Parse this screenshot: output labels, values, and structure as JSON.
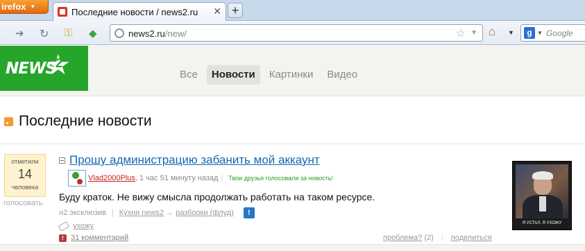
{
  "browser": {
    "app_button": "irefox",
    "tab_title": "Последние новости / news2.ru",
    "url_domain": "news2.ru",
    "url_path": "/new/",
    "search_placeholder": "Google"
  },
  "site": {
    "nav": [
      {
        "label": "Все",
        "active": false
      },
      {
        "label": "Новости",
        "active": true
      },
      {
        "label": "Картинки",
        "active": false
      },
      {
        "label": "Видео",
        "active": false
      }
    ]
  },
  "section": {
    "title": "Последние новости"
  },
  "story": {
    "votes_label_top": "отметили",
    "votes_count": "14",
    "votes_label_bottom": "человека",
    "vote_link": "голосовать",
    "title": "Прошу администрацию забанить мой аккаунт",
    "author": "Vlad2000Plus",
    "time": ", 1 час 51 минуту назад",
    "friends_note": "Твои друзья голосовали за новость!",
    "lead": "Буду краток. Не вижу смысла продолжать работать на таком ресурсе.",
    "source": "н2.эксклюзив",
    "category": "Кухня news2",
    "subcategory": "разборки (флуд)",
    "badge": "!",
    "tag": "ухожу",
    "comments": "31 комментарий",
    "report_label": "проблема?",
    "report_count": "(2)",
    "share_label": "поделиться",
    "thumb_caption": "Я УСТАЛ, Я УХОЖУ"
  }
}
